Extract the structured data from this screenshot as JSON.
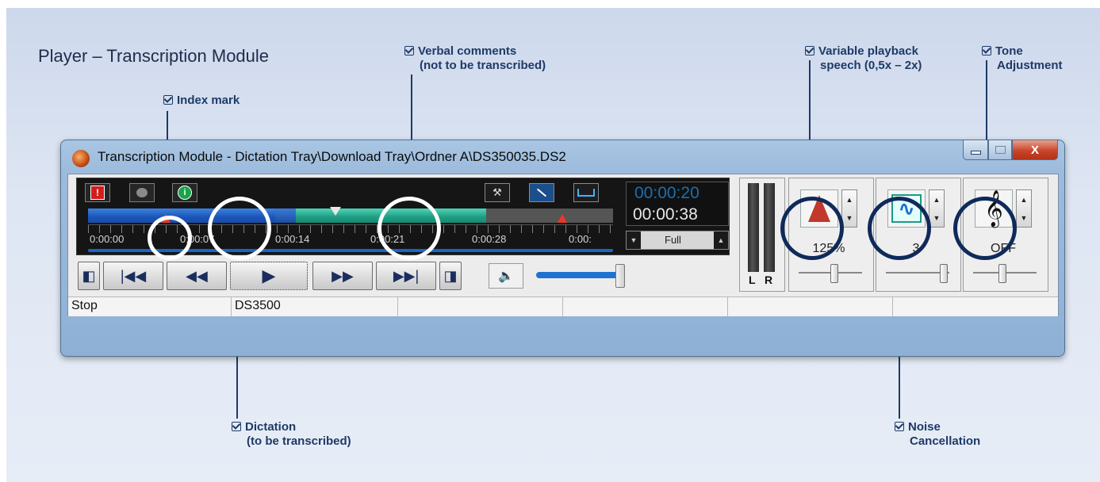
{
  "heading": "Player – Transcription Module",
  "callouts": {
    "index_mark": "Index mark",
    "verbal_1": "Verbal comments",
    "verbal_2": "(not to be transcribed)",
    "variable_1": "Variable playback",
    "variable_2": "speech (0,5x – 2x)",
    "tone_1": "Tone",
    "tone_2": "Adjustment",
    "dictation_1": "Dictation",
    "dictation_2": "(to be transcribed)",
    "noise_1": "Noise",
    "noise_2": "Cancellation"
  },
  "window": {
    "title": "Transcription Module - Dictation Tray\\Download Tray\\Ordner A\\DS350035.DS2",
    "close_label": "X"
  },
  "timeline": {
    "ticks": [
      "0:00:00",
      "0:00:07",
      "0:00:14",
      "0:00:21",
      "0:00:28",
      "0:00:"
    ]
  },
  "time": {
    "current": "00:00:20",
    "total": "00:00:38",
    "zoom": "Full"
  },
  "volume": {
    "level": 1.0
  },
  "meter": {
    "left_label": "L",
    "right_label": "R"
  },
  "controls": {
    "speed": {
      "value": "125%",
      "slider_position": 0.55
    },
    "noise": {
      "value": "3",
      "slider_position": 0.9
    },
    "tone": {
      "value": "OFF",
      "slider_position": 0.45
    }
  },
  "status": {
    "state": "Stop",
    "device": "DS3500"
  },
  "colors": {
    "dictation_segment": "#1b55b8",
    "comment_segment": "#1f9e84",
    "index_mark": "#e83a2a",
    "current_time": "#1b6fb0"
  }
}
